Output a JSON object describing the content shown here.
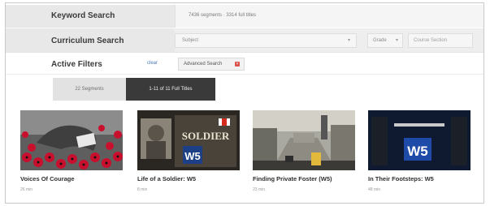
{
  "filters": {
    "keyword_label": "Keyword Search",
    "keyword_value": "7436 segments · 3314 full titles",
    "curriculum_label": "Curriculum Search",
    "subject_placeholder": "Subject",
    "grade_placeholder": "Grade",
    "course_placeholder": "Course Section",
    "active_label": "Active Filters",
    "clear_label": "clear",
    "active_chip": "Advanced Search",
    "chip_color": "#d9534f"
  },
  "tabs": {
    "segments": "22 Segments",
    "full_titles": "1-11 of 11 Full Titles"
  },
  "cards": [
    {
      "title": "Voices Of Courage",
      "duration": "26 min"
    },
    {
      "title": "Life of a Soldier: W5",
      "duration": "8 min"
    },
    {
      "title": "Finding Private Foster (W5)",
      "duration": "23 min"
    },
    {
      "title": "In Their Footsteps: W5",
      "duration": "48 min"
    }
  ],
  "thumb_text": {
    "soldier": "SOLDIER",
    "w5": "W5"
  }
}
